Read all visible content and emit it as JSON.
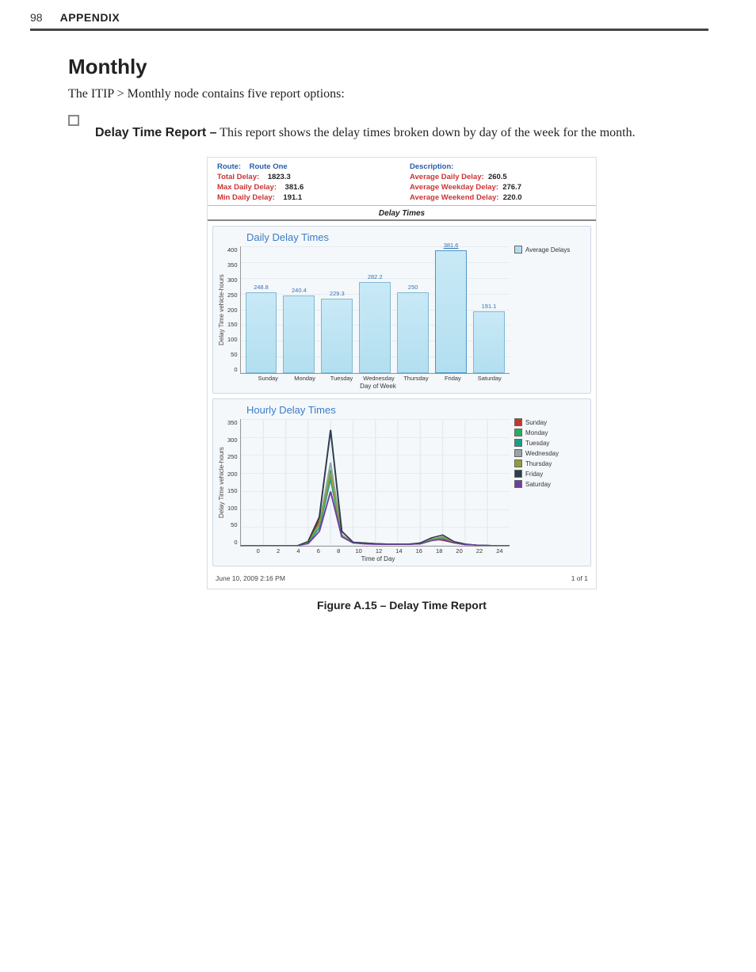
{
  "header": {
    "page_number": "98",
    "label": "APPENDIX"
  },
  "section": {
    "title": "Monthly",
    "intro": "The ITIP > Monthly node contains five report options:",
    "bullet_lead": "Delay Time Report –",
    "bullet_body": " This report shows the delay times broken down by day of the week for the month."
  },
  "report": {
    "left": {
      "route_lbl": "Route:",
      "route_val": "Route One",
      "total_lbl": "Total Delay:",
      "total_val": "1823.3",
      "max_lbl": "Max Daily Delay:",
      "max_val": "381.6",
      "min_lbl": "Min Daily Delay:",
      "min_val": "191.1"
    },
    "right": {
      "desc_lbl": "Description:",
      "avg_daily_lbl": "Average Daily Delay:",
      "avg_daily_val": "260.5",
      "avg_wkday_lbl": "Average Weekday Delay:",
      "avg_wkday_val": "276.7",
      "avg_wkend_lbl": "Average Weekend Delay:",
      "avg_wkend_val": "220.0"
    },
    "sub_header": "Delay Times",
    "footer_date": "June 10, 2009 2:16 PM",
    "footer_page": "1 of 1"
  },
  "figure_caption": "Figure A.15 – Delay Time Report",
  "chart_data": [
    {
      "id": "daily",
      "type": "bar",
      "title": "Daily Delay Times",
      "ylabel": "Delay Time vehicle-hours",
      "xlabel": "Day of Week",
      "ylim": [
        0,
        400
      ],
      "yticks": [
        400,
        350,
        300,
        250,
        200,
        150,
        100,
        50,
        0
      ],
      "categories": [
        "Sunday",
        "Monday",
        "Tuesday",
        "Wednesday",
        "Thursday",
        "Friday",
        "Saturday"
      ],
      "values": [
        248.8,
        240.4,
        229.3,
        282.2,
        250,
        381.6,
        191.1
      ],
      "highlight_index": 5,
      "legend": [
        "Average Delays"
      ],
      "legend_colors": [
        "#b2dff0"
      ]
    },
    {
      "id": "hourly",
      "type": "line",
      "title": "Hourly Delay Times",
      "ylabel": "Delay Time vehicle-hours",
      "xlabel": "Time of Day",
      "ylim": [
        0,
        350
      ],
      "yticks": [
        350,
        300,
        250,
        200,
        150,
        100,
        50,
        0
      ],
      "xticks": [
        0,
        2,
        4,
        6,
        8,
        10,
        12,
        14,
        16,
        18,
        20,
        22,
        24
      ],
      "legend": [
        "Sunday",
        "Monday",
        "Tuesday",
        "Wednesday",
        "Thursday",
        "Friday",
        "Saturday"
      ],
      "legend_colors": [
        "#c0392b",
        "#27ae60",
        "#16a085",
        "#95a5a6",
        "#8e9e3c",
        "#2c3e50",
        "#6b3fa0"
      ],
      "series": [
        {
          "name": "Sunday",
          "color": "#c0392b",
          "values": [
            0,
            0,
            0,
            0,
            0,
            0,
            10,
            70,
            190,
            40,
            10,
            8,
            6,
            5,
            5,
            4,
            8,
            20,
            15,
            8,
            4,
            2,
            1,
            0,
            0
          ]
        },
        {
          "name": "Monday",
          "color": "#27ae60",
          "values": [
            0,
            0,
            0,
            0,
            0,
            0,
            10,
            60,
            210,
            30,
            8,
            6,
            5,
            4,
            4,
            4,
            6,
            18,
            25,
            10,
            4,
            2,
            1,
            0,
            0
          ]
        },
        {
          "name": "Tuesday",
          "color": "#16a085",
          "values": [
            0,
            0,
            0,
            0,
            0,
            0,
            8,
            50,
            185,
            25,
            8,
            6,
            5,
            4,
            4,
            4,
            6,
            16,
            22,
            9,
            4,
            2,
            1,
            0,
            0
          ]
        },
        {
          "name": "Wednesday",
          "color": "#95a5a6",
          "values": [
            0,
            0,
            0,
            0,
            0,
            0,
            10,
            60,
            230,
            30,
            8,
            6,
            5,
            4,
            4,
            4,
            6,
            18,
            26,
            10,
            4,
            2,
            1,
            0,
            0
          ]
        },
        {
          "name": "Thursday",
          "color": "#8e9e3c",
          "values": [
            0,
            0,
            0,
            0,
            0,
            0,
            10,
            60,
            200,
            28,
            8,
            6,
            5,
            4,
            4,
            4,
            6,
            18,
            24,
            10,
            4,
            2,
            1,
            0,
            0
          ]
        },
        {
          "name": "Friday",
          "color": "#2c3e50",
          "values": [
            0,
            0,
            0,
            0,
            0,
            0,
            12,
            80,
            320,
            40,
            10,
            8,
            6,
            5,
            5,
            5,
            8,
            22,
            30,
            12,
            5,
            2,
            1,
            0,
            0
          ]
        },
        {
          "name": "Saturday",
          "color": "#6b3fa0",
          "values": [
            0,
            0,
            0,
            0,
            0,
            0,
            6,
            40,
            150,
            25,
            8,
            5,
            4,
            4,
            4,
            4,
            5,
            14,
            18,
            8,
            3,
            2,
            1,
            0,
            0
          ]
        }
      ]
    }
  ]
}
